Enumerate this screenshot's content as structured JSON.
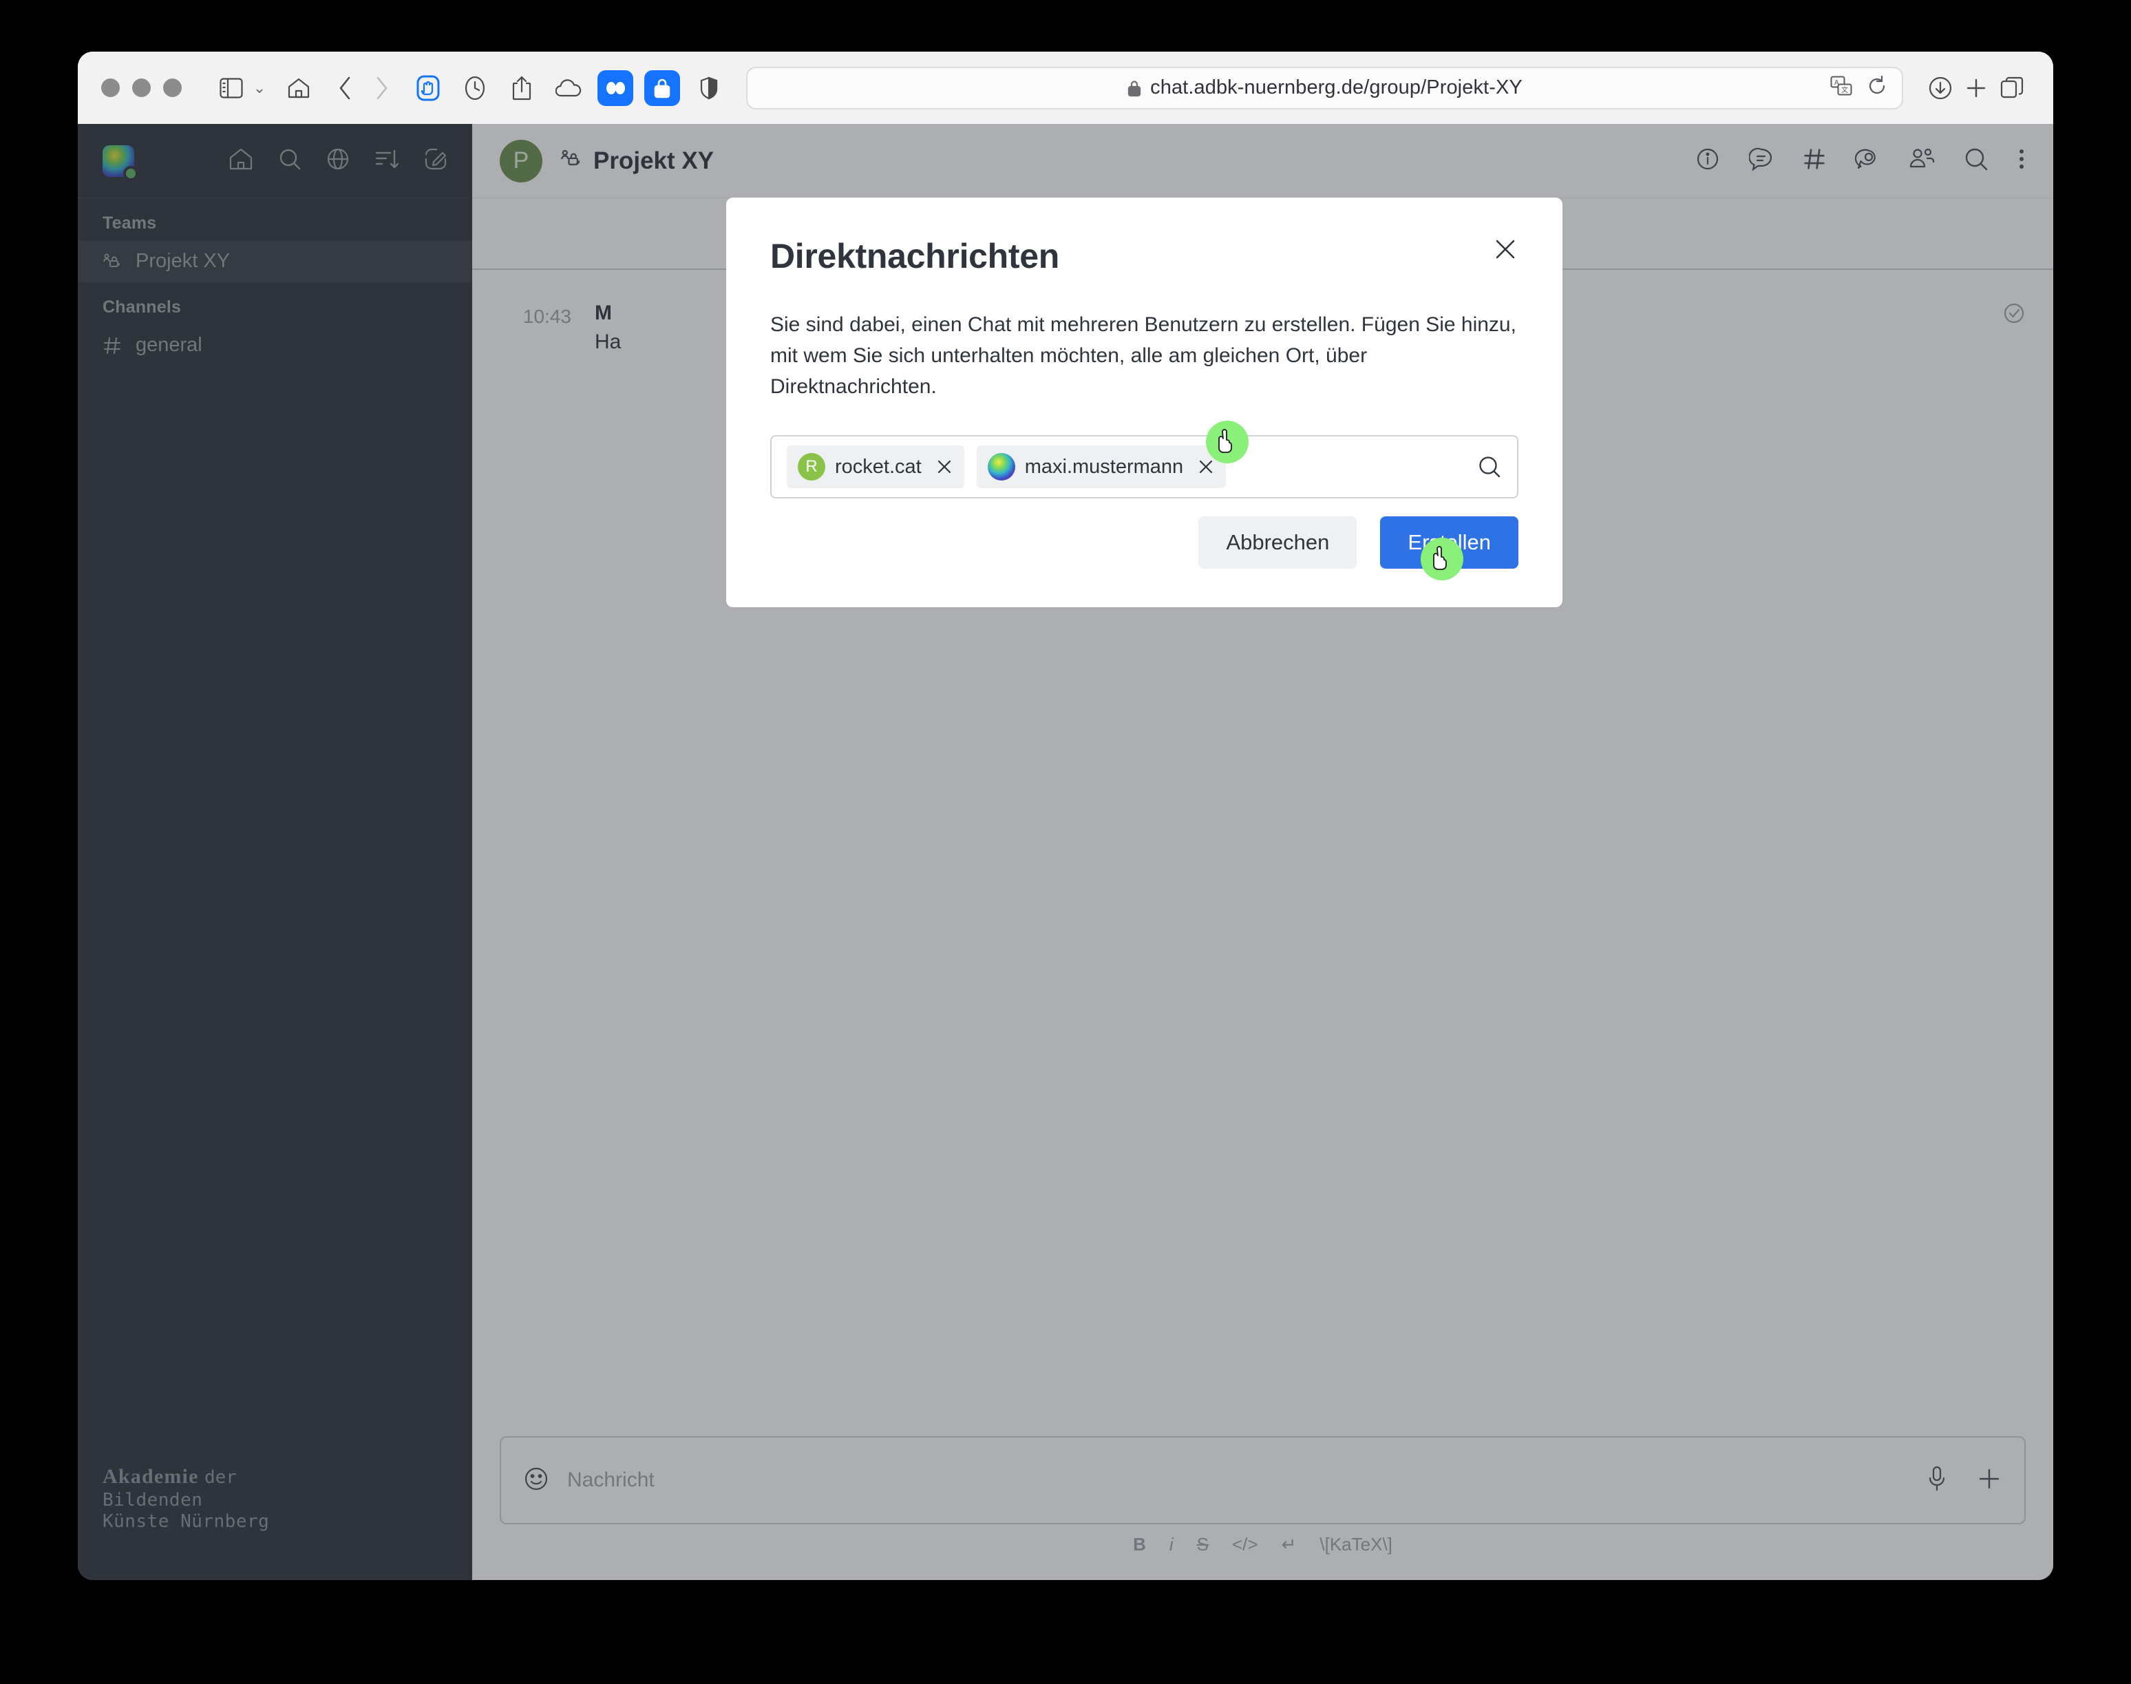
{
  "browser": {
    "url": "chat.adbk-nuernberg.de/group/Projekt-XY",
    "icons": {
      "sidebar_toggle": "sidebar-toggle-icon",
      "tabs_chevron": "chevron-down-icon",
      "home": "home-icon",
      "back": "back-chevron-icon",
      "forward": "forward-chevron-icon",
      "extension_hand": "hand-extension-icon",
      "history": "history-clock-icon",
      "share": "share-icon",
      "icloud": "cloud-icon",
      "dropbox": "dropbox-icon",
      "password": "lock-password-icon",
      "privacy": "shield-privacy-icon",
      "lock": "padlock-icon",
      "translate": "translate-icon",
      "reload": "reload-icon",
      "downloads": "downloads-icon",
      "new_tab": "plus-icon",
      "tab_overview": "tab-overview-icon"
    }
  },
  "sidebar": {
    "avatar": "user-avatar",
    "status": "online",
    "top_icons": [
      "home-icon",
      "search-icon",
      "directory-globe-icon",
      "sort-icon",
      "create-new-pencil-icon"
    ],
    "sections": [
      {
        "title": "Teams",
        "items": [
          {
            "label": "Projekt XY",
            "icon": "team-lock-icon",
            "active": true
          }
        ]
      },
      {
        "title": "Channels",
        "items": [
          {
            "label": "general",
            "icon": "hash-icon",
            "active": false
          }
        ]
      }
    ],
    "footer": {
      "line1_bold": "Akademie",
      "line1_rest": "der",
      "line2": "Bildenden",
      "line3": "Künste Nürnberg"
    }
  },
  "chat": {
    "avatar_letter": "P",
    "title": "Projekt XY",
    "title_icon": "team-lock-icon",
    "header_icons": [
      "info-circle-icon",
      "threads-icon",
      "hash-channels-icon",
      "discussions-icon",
      "team-members-icon",
      "search-icon",
      "kebab-menu-icon"
    ],
    "message": {
      "time": "10:43",
      "author": "M",
      "text": "Ha"
    },
    "read_receipt": "check-circle-icon",
    "composer": {
      "placeholder": "Nachricht",
      "emoji_icon": "emoji-smiley-icon",
      "mic_icon": "microphone-icon",
      "plus_icon": "plus-icon",
      "format_buttons": [
        "B",
        "i",
        "S",
        "</>",
        "↵",
        "\\[KaTeX\\]"
      ]
    }
  },
  "modal": {
    "title": "Direktnachrichten",
    "close_icon": "close-x-icon",
    "description": "Sie sind dabei, einen Chat mit mehreren Benutzern zu erstellen. Fügen Sie hinzu, mit wem Sie sich unterhalten möchten, alle am gleichen Ort, über Direktnachrichten.",
    "chips": [
      {
        "name": "rocket.cat",
        "avatar_letter": "R",
        "remove_icon": "remove-chip-x-icon"
      },
      {
        "name": "maxi.mustermann",
        "avatar_letter": "",
        "remove_icon": "remove-chip-x-icon"
      }
    ],
    "search_icon": "search-icon",
    "buttons": {
      "cancel": "Abbrechen",
      "create": "Erstellen"
    },
    "colors": {
      "primary": "#2f72e5",
      "secondary": "#eef0f2",
      "cursor_highlight": "#8af07a"
    }
  }
}
